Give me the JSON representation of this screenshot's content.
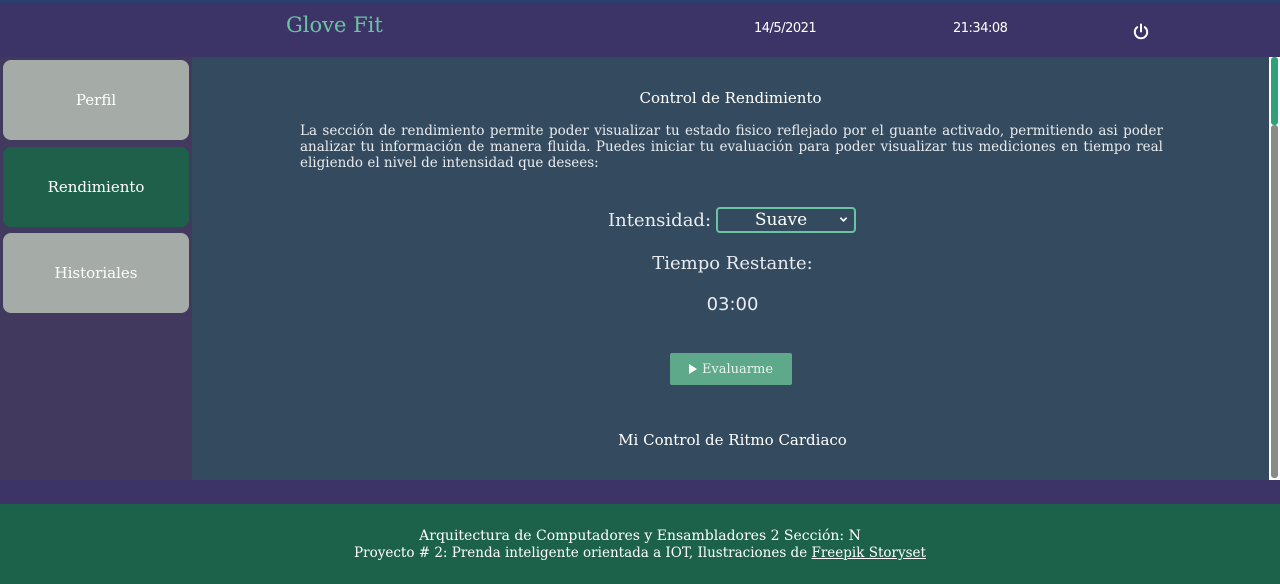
{
  "header": {
    "brand": "Glove Fit",
    "date": "14/5/2021",
    "time": "21:34:08",
    "power_icon": "power-icon"
  },
  "sidebar": {
    "items": [
      {
        "label": "Perfil",
        "active": false
      },
      {
        "label": "Rendimiento",
        "active": true
      },
      {
        "label": "Historiales",
        "active": false
      }
    ]
  },
  "main": {
    "title": "Control de Rendimiento",
    "description": "La sección de rendimiento permite poder visualizar tu estado fisico reflejado por el guante activado, permitiendo asi poder analizar tu información de manera fluida. Puedes iniciar tu evaluación para poder visualizar tus mediciones en tiempo real eligiendo el nivel de intensidad que desees:",
    "intensity_label": "Intensidad:",
    "intensity_value": "Suave",
    "remaining_label": "Tiempo Restante:",
    "remaining_value": "03:00",
    "eval_button": "Evaluarme",
    "heart_title": "Mi Control de Ritmo Cardiaco"
  },
  "footer": {
    "line1": "Arquitectura de Computadores y Ensambladores 2 Sección: N",
    "line2_prefix": "Proyecto # 2: Prenda inteligente orientada a IOT, Ilustraciones de ",
    "line2_link": "Freepik Storyset"
  },
  "colors": {
    "accent": "#6cc3a1",
    "active_nav": "#1e6049",
    "footer": "#1c614a",
    "header": "#3c3466"
  }
}
